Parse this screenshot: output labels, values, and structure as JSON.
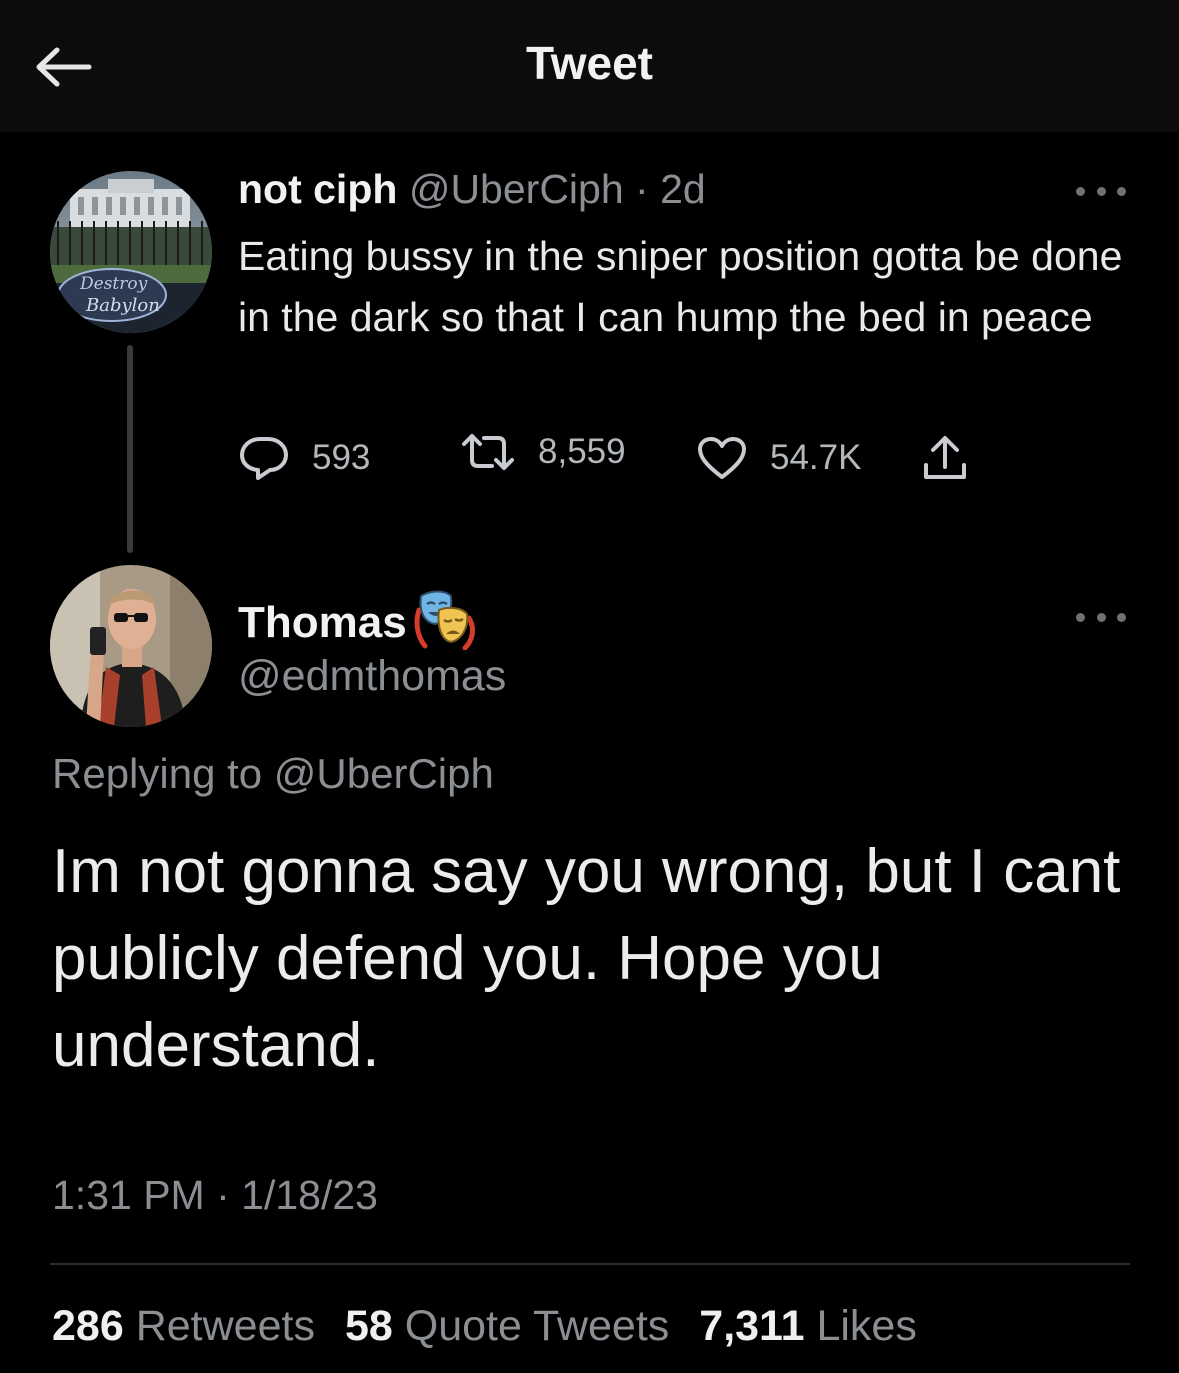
{
  "topbar": {
    "title": "Tweet"
  },
  "parent_tweet": {
    "display_name": "not ciph",
    "handle": "@UberCiph",
    "separator": "·",
    "age": "2d",
    "avatar_sign_text": [
      "Destroy",
      "Babylon"
    ],
    "text": "Eating bussy in the sniper position gotta be done in the dark so that I can hump the bed in peace",
    "replies": "593",
    "retweets": "8,559",
    "likes": "54.7K"
  },
  "reply_tweet": {
    "display_name": "Thomas",
    "badge_icon": "theater-masks-emoji",
    "handle": "@edmthomas",
    "replying_prefix": "Replying to",
    "replying_to": "@UberCiph",
    "text": "Im not gonna say you wrong, but I cant publicly defend you. Hope you understand.",
    "time": "1:31 PM",
    "separator": "·",
    "date": "1/18/23",
    "stats": [
      {
        "count": "286",
        "label": "Retweets"
      },
      {
        "count": "58",
        "label": "Quote Tweets"
      },
      {
        "count": "7,311",
        "label": "Likes"
      }
    ]
  },
  "colors": {
    "background": "#000000",
    "topbar": "#0c0c0c",
    "primary_text": "#e7e9ea",
    "secondary_text": "#8b8f93",
    "divider": "#2a2a2a"
  }
}
